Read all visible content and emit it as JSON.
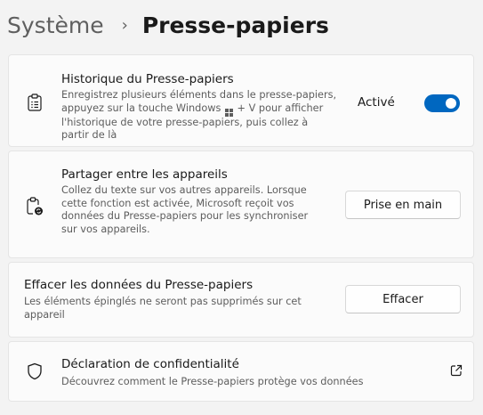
{
  "breadcrumb": {
    "parent": "Système",
    "separator": "›",
    "current": "Presse-papiers"
  },
  "history": {
    "icon": "clipboard-list-icon",
    "title": "Historique du Presse-papiers",
    "desc_lines": [
      "Enregistrez plusieurs éléments dans le presse-papiers,",
      "appuyez sur la touche Windows",
      "+ V pour afficher",
      "l'historique de votre presse-papiers, puis collez à",
      "partir de là"
    ],
    "toggle_label": "Activé",
    "toggle_on": true
  },
  "share": {
    "icon": "clipboard-sync-icon",
    "title": "Partager entre les appareils",
    "desc_lines": [
      "Collez du texte sur vos autres appareils. Lorsque",
      "cette fonction est activée, Microsoft reçoit vos",
      "données du Presse-papiers pour les synchroniser",
      "sur vos appareils."
    ],
    "button_label": "Prise en main"
  },
  "clear": {
    "title": "Effacer les données du Presse-papiers",
    "desc_lines": [
      "Les éléments épinglés ne seront pas supprimés sur cet",
      "appareil"
    ],
    "button_label": "Effacer"
  },
  "privacy": {
    "icon": "shield-icon",
    "title": "Déclaration de confidentialité",
    "desc": "Découvrez comment le Presse-papiers protège vos données",
    "link_icon": "external-link-icon"
  },
  "colors": {
    "accent": "#0067c0",
    "background": "#f3f3f3",
    "card": "#fbfbfb",
    "secondary_text": "#5d5d5d"
  }
}
